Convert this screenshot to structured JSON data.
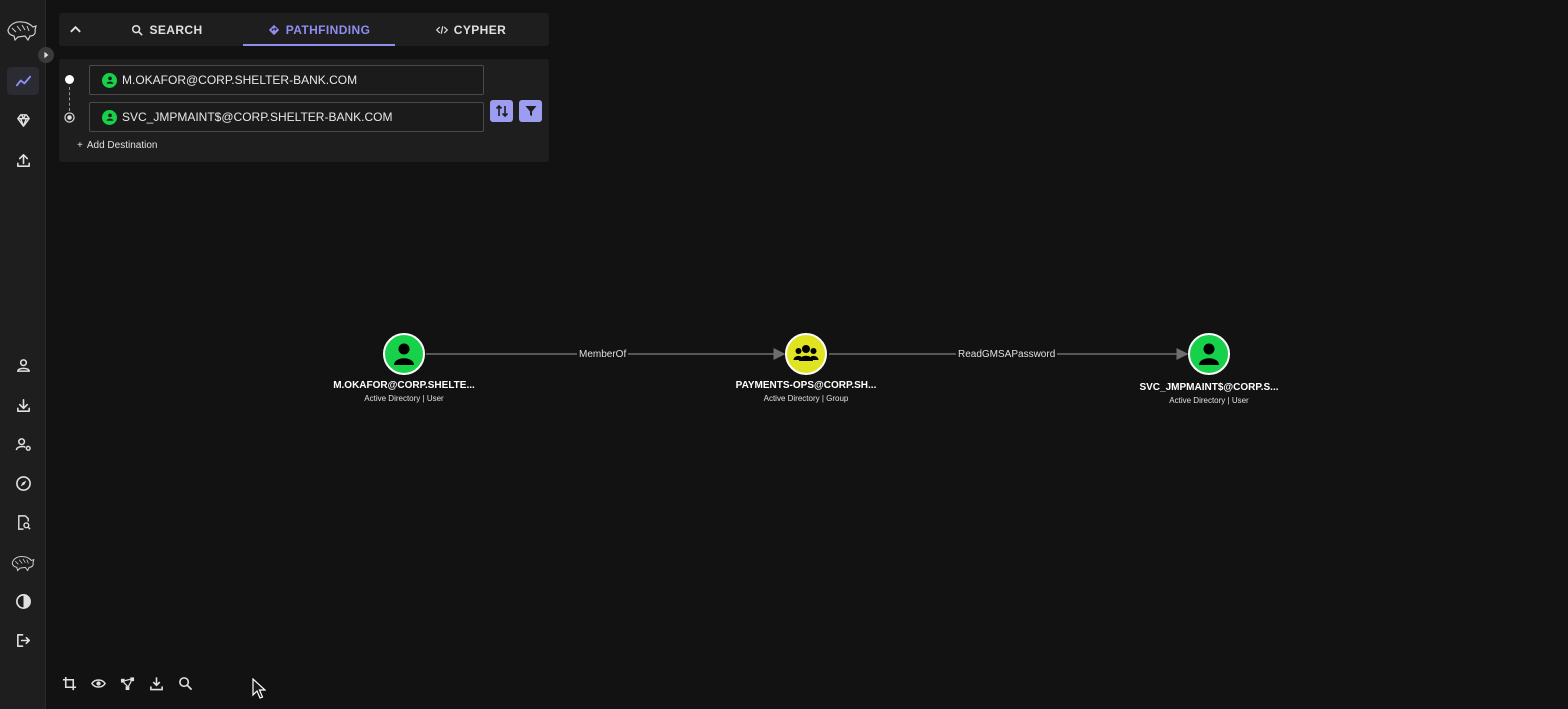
{
  "colors": {
    "accent": "#8e8ef0",
    "user_node": "#17d14a",
    "group_node": "#dfe320",
    "background": "#121212",
    "panel": "#1e1e1e"
  },
  "sidebar": {
    "top_items": [
      {
        "icon": "trend-line-icon",
        "active": true
      },
      {
        "icon": "gem-icon",
        "active": false
      },
      {
        "icon": "upload-icon",
        "active": false
      }
    ],
    "bottom_items": [
      {
        "icon": "user-icon"
      },
      {
        "icon": "download-icon"
      },
      {
        "icon": "user-cog-icon"
      },
      {
        "icon": "compass-icon"
      },
      {
        "icon": "file-search-icon"
      },
      {
        "icon": "bloodhound-icon"
      },
      {
        "icon": "contrast-icon"
      },
      {
        "icon": "logout-icon"
      }
    ]
  },
  "tabs": {
    "search": "SEARCH",
    "pathfinding": "PATHFINDING",
    "cypher": "CYPHER",
    "active": "pathfinding"
  },
  "pathfinding": {
    "start_value": "M.OKAFOR@CORP.SHELTER-BANK.COM",
    "destination_value": "SVC_JMPMAINT$@CORP.SHELTER-BANK.COM",
    "add_destination": "Add Destination",
    "add_prefix": "+"
  },
  "graph": {
    "nodes": [
      {
        "name": "M.OKAFOR@CORP.SHELTE...",
        "subtitle": "Active Directory | User",
        "kind": "user"
      },
      {
        "name": "PAYMENTS-OPS@CORP.SH...",
        "subtitle": "Active Directory | Group",
        "kind": "group"
      },
      {
        "name": "SVC_JMPMAINT$@CORP.S...",
        "subtitle": "Active Directory | User",
        "kind": "user"
      }
    ],
    "edges": [
      {
        "label": "MemberOf"
      },
      {
        "label": "ReadGMSAPassword"
      }
    ]
  },
  "toolbar": {
    "items": [
      "crop-icon",
      "eye-icon",
      "graph-layout-icon",
      "export-icon",
      "search-icon"
    ]
  }
}
